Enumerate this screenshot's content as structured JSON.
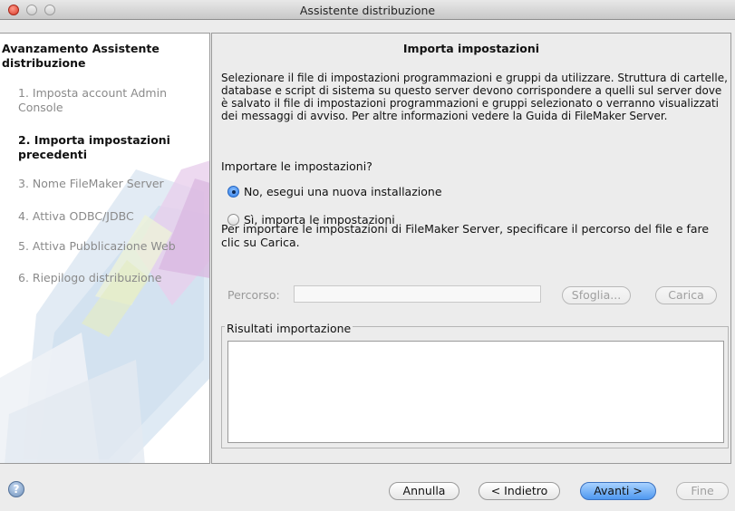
{
  "window": {
    "title": "Assistente distribuzione"
  },
  "sidebar": {
    "heading": "Avanzamento Assistente distribuzione",
    "steps": [
      {
        "label": "1. Imposta account Admin Console",
        "active": false
      },
      {
        "label": "2. Importa impostazioni precedenti",
        "active": true
      },
      {
        "label": "3. Nome FileMaker Server",
        "active": false
      },
      {
        "label": "4. Attiva ODBC/JDBC",
        "active": false
      },
      {
        "label": "5. Attiva Pubblicazione Web",
        "active": false
      },
      {
        "label": "6. Riepilogo distribuzione",
        "active": false
      }
    ]
  },
  "main": {
    "title": "Importa impostazioni",
    "description": "Selezionare il file di impostazioni programmazioni e gruppi da utilizzare. Struttura di cartelle, database e script di sistema su questo server devono corrispondere a quelli sul server dove è salvato il file di impostazioni programmazioni e gruppi selezionato o verranno visualizzati dei messaggi di avviso. Per altre informazioni vedere la Guida di FileMaker Server.",
    "question": "Importare le impostazioni?",
    "radio_no": "No, esegui una nuova installazione",
    "radio_yes": "Sì, importa le impostazioni",
    "selected_option": "No, esegui una nuova installazione",
    "import_info": "Per importare le impostazioni di FileMaker Server, specificare il percorso del file e fare clic su Carica.",
    "path_label": "Percorso:",
    "path_value": "",
    "browse_button": "Sfoglia...",
    "load_button": "Carica",
    "results_label": "Risultati importazione",
    "results_text": ""
  },
  "footer": {
    "help_icon": "question-mark-icon",
    "cancel": "Annulla",
    "back": "< Indietro",
    "next": "Avanti >",
    "finish": "Fine"
  },
  "colors": {
    "accent": "#4f98f0",
    "close_button": "#d83a28"
  }
}
